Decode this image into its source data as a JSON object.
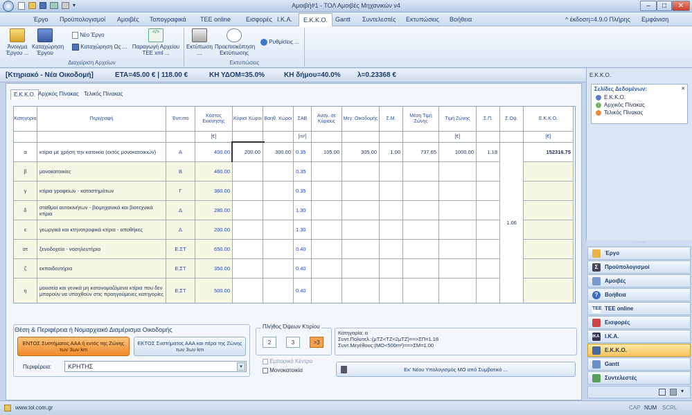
{
  "window": {
    "title": "Αμοιβή#1 - ΤΟΛ Αμοιβές Μηχανικών v4"
  },
  "menu": {
    "items": [
      "Έργο",
      "Προϋπολογισμοί",
      "Αμοιβές",
      "Τοπογραφικά",
      "TEE online",
      "Εισφορές",
      "Ι.Κ.Α.",
      "Ε.Κ.Κ.Ο.",
      "Gantt",
      "Συντελεστές",
      "Εκτυπώσεις",
      "Βοήθεια"
    ],
    "version": "^ έκδοση=4.9.0 Πλήρης",
    "appearance": "Εμφάνιση"
  },
  "ribbon": {
    "open": "Άνοιγμα Έργου ...",
    "save": "Καταχώρηση Έργου",
    "new": "Νέο Έργο",
    "save_as": "Καταχώρηση Ως ...",
    "produce": "Παραγωγή Αρχείου ΤΕΕ xml ...",
    "group_files": "Διαχείριση Αρχείων",
    "print": "Εκτύπωση ...",
    "preview": "Προεπισκόπηση Εκτύπωσης",
    "settings": "Ρυθμίσεις ...",
    "group_print": "Εκτυπώσεις"
  },
  "info": {
    "project": "[Κτηριακό - Νέα Οικοδομή]",
    "eta": "ΕΤΑ=45.00 € | 118.00 €",
    "kh_ydom": "ΚΗ ΥΔΟΜ=35.0%",
    "kh_dimou": "ΚΗ δήμου=40.0%",
    "lambda": "λ=0.23368 €"
  },
  "tabs": [
    "Ε.Κ.Κ.Ο.",
    "Αρχικός Πίνακας",
    "Τελικός Πίνακας"
  ],
  "table": {
    "headers": {
      "cat": "Κατηγορία",
      "desc": "Περιγραφή",
      "form": "Έντυπο",
      "cost": "Κόστος Εκκίνησης",
      "main": "Κύριοι Χώροι",
      "aux": "Βοηθ. Χώροι",
      "sab": "ΣΑΒ",
      "anag": "Αναγ. σε Κύριους",
      "meg": "Μεγ. Οικοδομής",
      "sm": "Σ.Μ.",
      "mesi": "Μέση Τιμή Ζώνης",
      "zoni": "Τιμή Ζώνης",
      "sp": "Σ.Π.",
      "soi": "Σ.Οψ.",
      "ekko": "Ε.Κ.Κ.Ο."
    },
    "units": {
      "euro": "[€]",
      "m2": "[m²]",
      "euro2": "[€]",
      "euro3": "[€]"
    },
    "rows": [
      {
        "cat": "α",
        "desc": "κτίρια με χρήση την κατοικία (εκτός μονοκατοικιών)",
        "form": "Α",
        "cost": "400.00",
        "main": "200.00",
        "aux": "300.00",
        "sab": "0.35",
        "anag": "105.00",
        "meg": "305.00",
        "sm": "1.00",
        "mesi": "737.65",
        "zoni": "1000.00",
        "sp": "1.18",
        "ekko": "152316.75"
      },
      {
        "cat": "β",
        "desc": "μονοκατοικίες",
        "form": "Β",
        "cost": "460.00",
        "sab": "0.35"
      },
      {
        "cat": "γ",
        "desc": "κτίρια γραφείων - καταστημάτων",
        "form": "Γ",
        "cost": "360.00",
        "sab": "0.35"
      },
      {
        "cat": "δ",
        "desc": "σταθμοί αυτοκινήτων - βιομηχανικά και βιοτεχνικά κτίρια",
        "form": "Δ",
        "cost": "280.00",
        "sab": "1.30"
      },
      {
        "cat": "ε",
        "desc": "γεωργικά και κτηνοτροφικά κτίρια - αποθήκες",
        "form": "Δ",
        "cost": "200.00",
        "sab": "1.30"
      },
      {
        "cat": "στ",
        "desc": "ξενοδοχεία - νοσηλευτήρια",
        "form": "Ε.ΣΤ",
        "cost": "650.00",
        "sab": "0.40"
      },
      {
        "cat": "ζ",
        "desc": "εκπαιδευτήρια",
        "form": "Ε.ΣΤ",
        "cost": "350.00",
        "sab": "0.40"
      },
      {
        "cat": "η",
        "desc": "μουσεία και γενικά μη κατονομαζόμενα κτίρια που δεν μπορούν να υπαχθούν στις προηγούμενες κατηγορίες",
        "form": "Ε.ΣΤ",
        "cost": "500.00",
        "sab": "0.40"
      }
    ],
    "soi_value": "1.06"
  },
  "bottom": {
    "location_title": "Θέση & Περιφέρεια ή Νομαρχιακό Διαμέρισμα Οικοδομής",
    "inside": "ΕΝΤΟΣ Συστήματος ΑΑΑ ή εντός της Ζώνης των 3ων km",
    "outside": "ΕΚΤΟΣ Συστήματος ΑΑΑ και πέρα της Ζώνης των 3ων km",
    "region_label": "Περιφέρεια:",
    "region_value": "ΚΡΗΤΗΣ",
    "facades_title": "Πλήθος Όψεων Κτιρίου",
    "f2": "2",
    "f3": "3",
    "f4": ">3",
    "commercial": "Εμπορικό Κέντρο",
    "detached": "Μονοκατοικία",
    "summary1": "Κατηγορία: α",
    "summary2": "Συντ.Πολυτελ.:(μΤΖ<ΤΖ<2μΤΖ)==>ΣΠ=1.18",
    "summary3": "Συντ.Μεγέθους:(ΜΟ<500m²)==>ΣΜ=1.00",
    "recalc": "Εκ' Νέου Υπολογισμός ΜΟ από Συμβατικό ..."
  },
  "side": {
    "title": "Ε.Κ.Κ.Ο.",
    "pages_title": "Σελίδες Δεδομένων:",
    "pages": [
      "Ε.Κ.Κ.Ο.",
      "Αρχικός Πίνακας",
      "Τελικός Πίνακας"
    ],
    "nav": [
      "Έργο",
      "Προϋπολογισμοί",
      "Αμοιβές",
      "Βοήθεια",
      "TEE online",
      "Εισφορές",
      "Ι.Κ.Α.",
      "Ε.Κ.Κ.Ο.",
      "Gantt",
      "Συντελεστές"
    ]
  },
  "status": {
    "url": "www.tol.com.gr",
    "cap": "CAP",
    "num": "NUM",
    "scrl": "SCRL"
  }
}
